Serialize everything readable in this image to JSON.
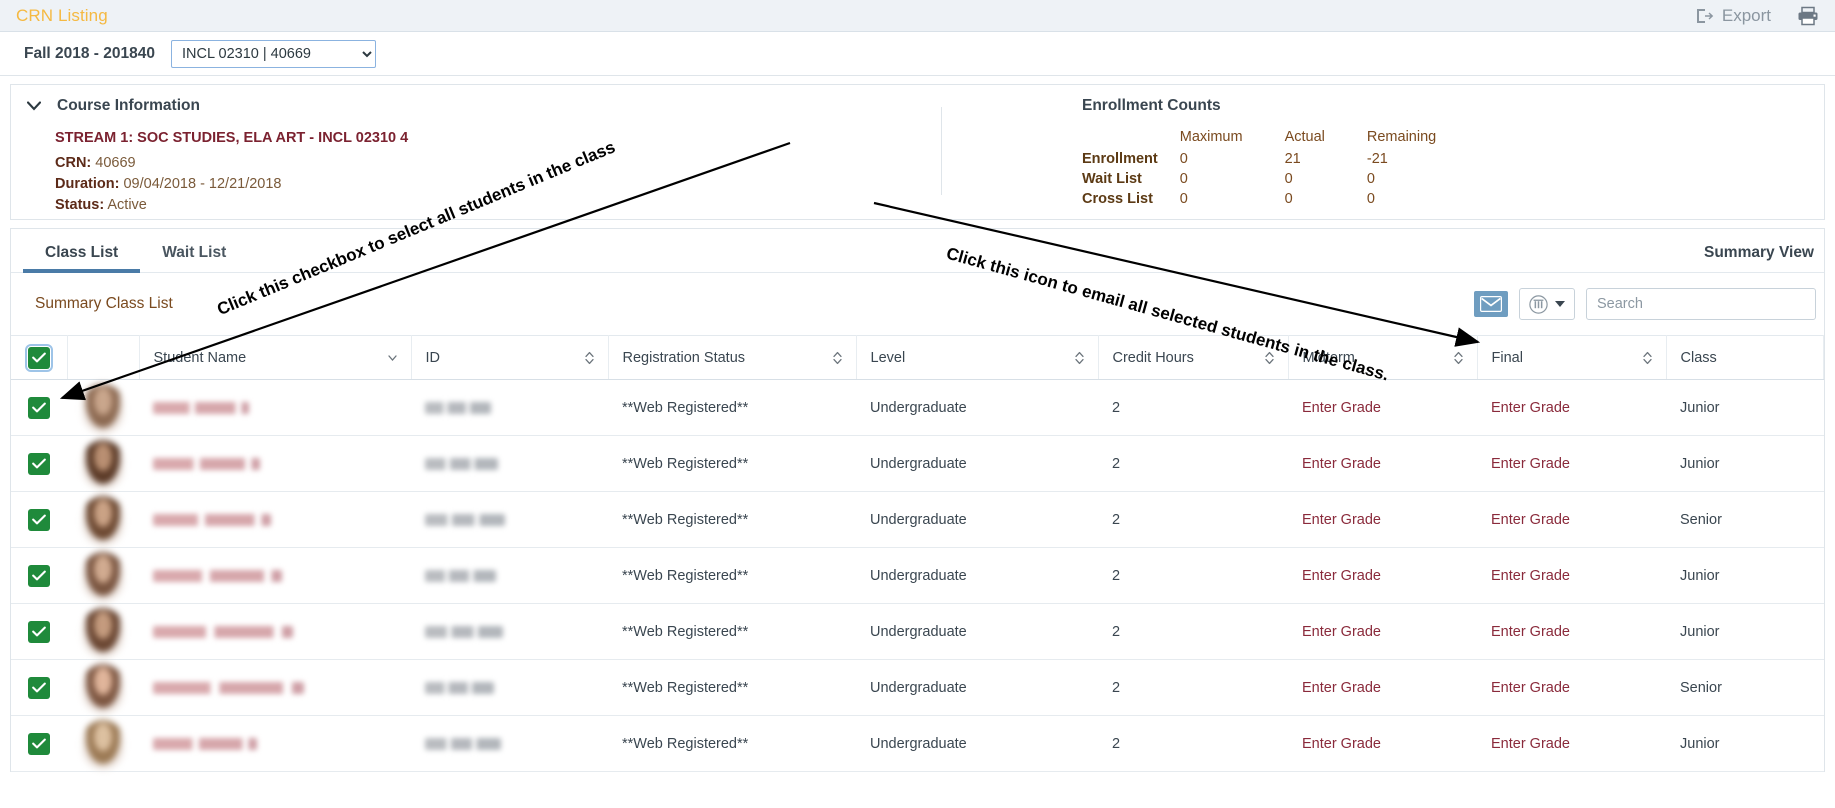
{
  "topbar": {
    "title": "CRN Listing",
    "export_label": "Export",
    "export_icon": "export-icon",
    "print_icon": "printer-icon"
  },
  "termstrip": {
    "term_label": "Fall 2018 - 201840",
    "crn_selected": "INCL 02310 | 40669",
    "crn_options": [
      "INCL 02310 | 40669"
    ]
  },
  "course_information": {
    "section_title": "Course Information",
    "collapse_icon": "chevron-down-icon",
    "course_title": "STREAM 1: SOC STUDIES, ELA ART - INCL 02310 4",
    "fields": [
      {
        "label": "CRN:",
        "value": "40669"
      },
      {
        "label": "Duration:",
        "value": "09/04/2018 - 12/21/2018"
      },
      {
        "label": "Status:",
        "value": "Active"
      }
    ]
  },
  "enrollment_counts": {
    "title": "Enrollment Counts",
    "columns": [
      "",
      "Maximum",
      "Actual",
      "Remaining"
    ],
    "rows": [
      {
        "label": "Enrollment",
        "maximum": "0",
        "actual": "21",
        "remaining": "-21"
      },
      {
        "label": "Wait List",
        "maximum": "0",
        "actual": "0",
        "remaining": "0"
      },
      {
        "label": "Cross List",
        "maximum": "0",
        "actual": "0",
        "remaining": "0"
      }
    ]
  },
  "tabs": [
    {
      "label": "Class List",
      "active": true
    },
    {
      "label": "Wait List",
      "active": false
    }
  ],
  "summary_view_label": "Summary View",
  "toolbar": {
    "list_title": "Summary Class List",
    "mail_icon": "envelope-icon",
    "columns_icon": "columns-icon",
    "columns_caret_icon": "caret-down-icon",
    "search_placeholder": "Search",
    "search_value": ""
  },
  "table": {
    "header_checkbox_checked": true,
    "columns": [
      {
        "key": "check",
        "label": "",
        "sort": "none"
      },
      {
        "key": "avatar",
        "label": "",
        "sort": "none"
      },
      {
        "key": "name",
        "label": "Student Name",
        "sort": "desc"
      },
      {
        "key": "id",
        "label": "ID",
        "sort": "both"
      },
      {
        "key": "reg",
        "label": "Registration Status",
        "sort": "both"
      },
      {
        "key": "level",
        "label": "Level",
        "sort": "both"
      },
      {
        "key": "credit",
        "label": "Credit Hours",
        "sort": "both"
      },
      {
        "key": "mid",
        "label": "Midterm",
        "sort": "both"
      },
      {
        "key": "final",
        "label": "Final",
        "sort": "both"
      },
      {
        "key": "class",
        "label": "Class",
        "sort": "none"
      }
    ],
    "rows": [
      {
        "checked": true,
        "name": "[redacted]",
        "id": "[redacted]",
        "reg": "**Web Registered**",
        "level": "Undergraduate",
        "credit": "2",
        "mid": "Enter Grade",
        "final": "Enter Grade",
        "class": "Junior"
      },
      {
        "checked": true,
        "name": "[redacted]",
        "id": "[redacted]",
        "reg": "**Web Registered**",
        "level": "Undergraduate",
        "credit": "2",
        "mid": "Enter Grade",
        "final": "Enter Grade",
        "class": "Junior"
      },
      {
        "checked": true,
        "name": "[redacted]",
        "id": "[redacted]",
        "reg": "**Web Registered**",
        "level": "Undergraduate",
        "credit": "2",
        "mid": "Enter Grade",
        "final": "Enter Grade",
        "class": "Senior"
      },
      {
        "checked": true,
        "name": "[redacted]",
        "id": "[redacted]",
        "reg": "**Web Registered**",
        "level": "Undergraduate",
        "credit": "2",
        "mid": "Enter Grade",
        "final": "Enter Grade",
        "class": "Junior"
      },
      {
        "checked": true,
        "name": "[redacted]",
        "id": "[redacted]",
        "reg": "**Web Registered**",
        "level": "Undergraduate",
        "credit": "2",
        "mid": "Enter Grade",
        "final": "Enter Grade",
        "class": "Junior"
      },
      {
        "checked": true,
        "name": "[redacted]",
        "id": "[redacted]",
        "reg": "**Web Registered**",
        "level": "Undergraduate",
        "credit": "2",
        "mid": "Enter Grade",
        "final": "Enter Grade",
        "class": "Senior"
      },
      {
        "checked": true,
        "name": "[redacted]",
        "id": "[redacted]",
        "reg": "**Web Registered**",
        "level": "Undergraduate",
        "credit": "2",
        "mid": "Enter Grade",
        "final": "Enter Grade",
        "class": "Junior"
      }
    ]
  },
  "annotations": [
    {
      "id": "anno1",
      "text": "Click this checkbox to select all students in the class"
    },
    {
      "id": "anno2",
      "text": "Click this icon to email all selected students in the class."
    }
  ],
  "colors": {
    "accent_yellow": "#f5b942",
    "maroon": "#7b2230",
    "checkbox_green": "#1f8a3b",
    "tab_underline": "#4a7ba7",
    "mail_blue": "#6f9dc0"
  }
}
